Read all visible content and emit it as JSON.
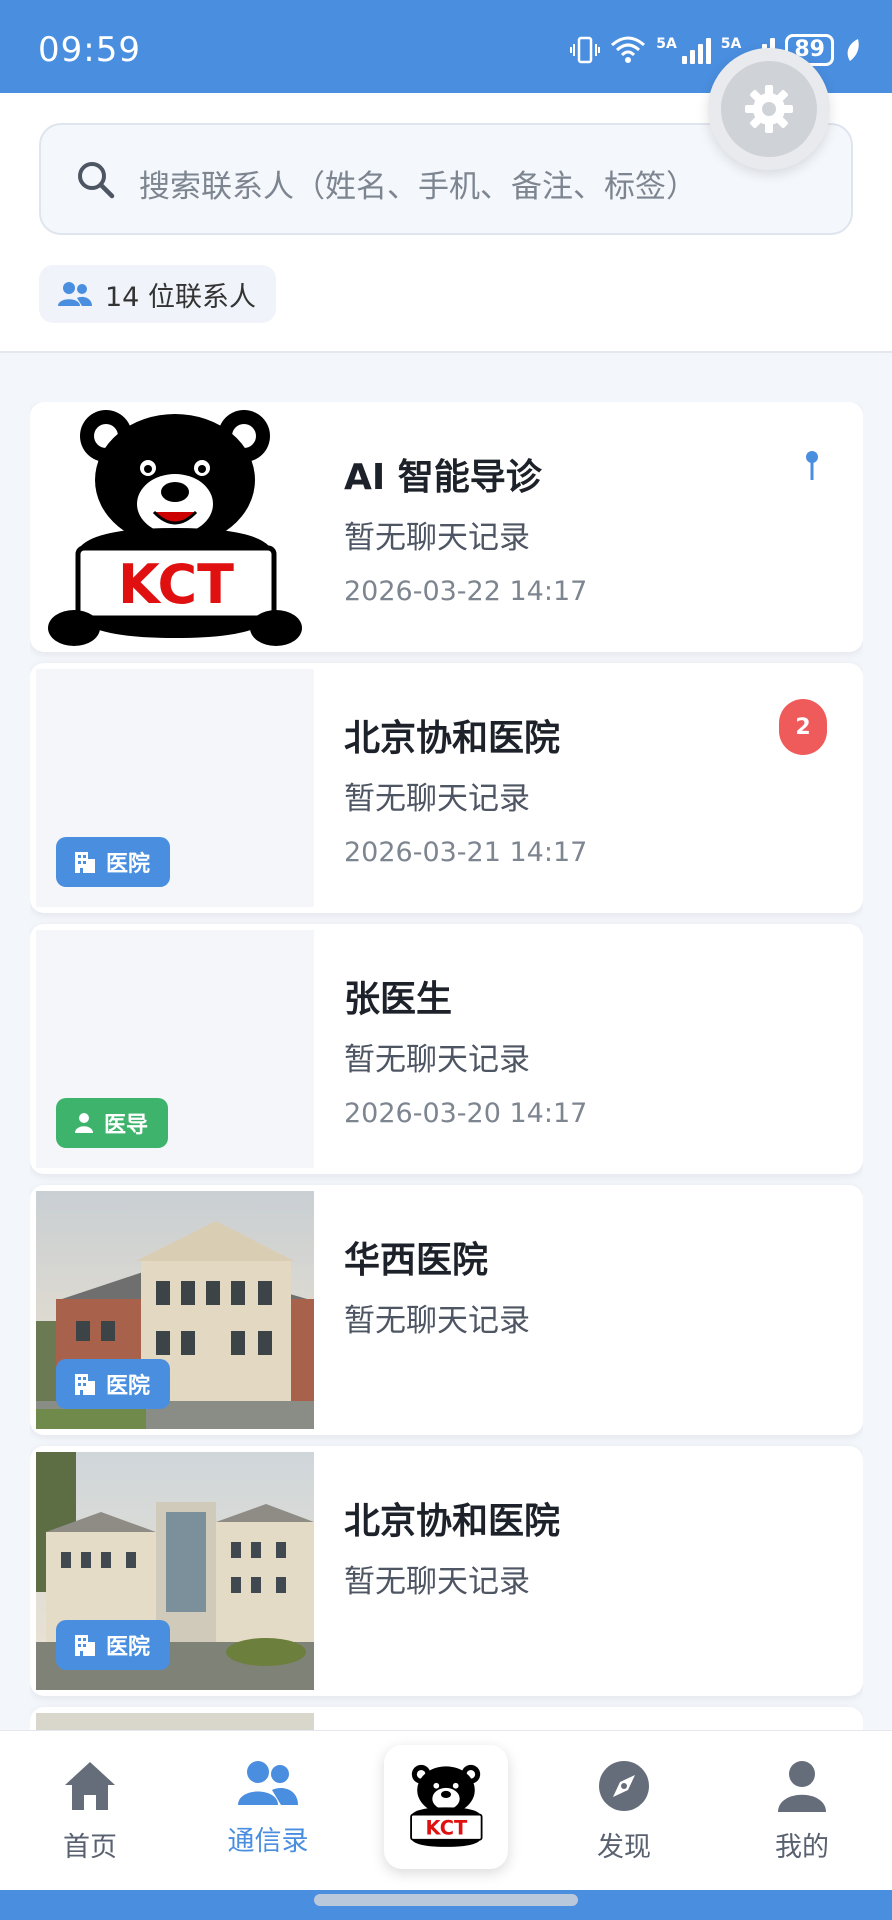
{
  "status_bar": {
    "time": "09:59",
    "network_1": "5A",
    "network_2": "5A",
    "battery": "89"
  },
  "search": {
    "placeholder": "搜索联系人（姓名、手机、备注、标签）"
  },
  "contacts_count": {
    "label": "14 位联系人"
  },
  "contacts": [
    {
      "name": "AI 智能导诊",
      "last_message": "暂无聊天记录",
      "time": "2026-03-22 14:17",
      "avatar": "kct-bear-logo",
      "pinned": true
    },
    {
      "name": "北京协和医院",
      "last_message": "暂无聊天记录",
      "time": "2026-03-21 14:17",
      "tag": "医院",
      "tag_icon": "building-icon",
      "unread": "2"
    },
    {
      "name": "张医生",
      "last_message": "暂无聊天记录",
      "time": "2026-03-20 14:17",
      "tag": "医导",
      "tag_icon": "person-icon"
    },
    {
      "name": "华西医院",
      "last_message": "暂无聊天记录",
      "tag": "医院",
      "tag_icon": "building-icon",
      "photo": "hospital-building-photo"
    },
    {
      "name": "北京协和医院",
      "last_message": "暂无聊天记录",
      "tag": "医院",
      "tag_icon": "building-icon",
      "photo": "hospital-building-photo"
    }
  ],
  "tabbar": {
    "home": "首页",
    "contacts": "通信录",
    "discover": "发现",
    "mine": "我的"
  },
  "colors": {
    "primary": "#4a8ee0",
    "green_tag": "#3db36c",
    "unread_red": "#ef5b5b"
  }
}
